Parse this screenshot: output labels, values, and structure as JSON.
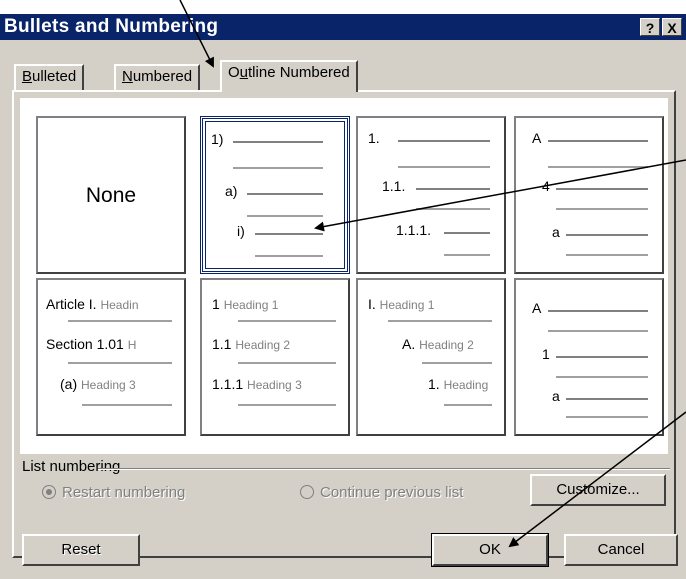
{
  "window": {
    "title": "Bullets and Numbering",
    "help_label": "?",
    "close_label": "X"
  },
  "tabs": [
    {
      "label": "Bulleted",
      "accel": "B",
      "rest": "ulleted"
    },
    {
      "label": "Numbered",
      "accel": "N",
      "rest": "umbered"
    },
    {
      "label": "Outline Numbered",
      "pre": "O",
      "accel": "u",
      "rest": "tline Numbered"
    }
  ],
  "gallery": {
    "none_label": "None",
    "card2": [
      "1)",
      "a)",
      "i)"
    ],
    "card3": [
      "1.",
      "1.1.",
      "1.1.1."
    ],
    "card4": [
      "A",
      "4",
      "a"
    ],
    "card5": [
      {
        "num": "Article I.",
        "head": "Headin"
      },
      {
        "num": "Section 1.01",
        "head": "H"
      },
      {
        "num": "(a)",
        "head": "Heading 3"
      }
    ],
    "card6": [
      {
        "num": "1",
        "head": "Heading 1"
      },
      {
        "num": "1.1",
        "head": "Heading 2"
      },
      {
        "num": "1.1.1",
        "head": "Heading 3"
      }
    ],
    "card7": [
      {
        "num": "I.",
        "head": "Heading 1"
      },
      {
        "num": "A.",
        "head": "Heading 2"
      },
      {
        "num": "1.",
        "head": "Heading"
      }
    ],
    "card8": [
      "A",
      "1",
      "a"
    ]
  },
  "list_numbering": {
    "group_label": "List numbering",
    "restart_label": "Restart numbering",
    "continue_label": "Continue previous list",
    "selected": "restart"
  },
  "buttons": {
    "customize": "Customize...",
    "reset": "Reset",
    "ok": "OK",
    "cancel": "Cancel"
  },
  "colors": {
    "titlebar": "#0a246a",
    "face": "#d4d0c8"
  }
}
